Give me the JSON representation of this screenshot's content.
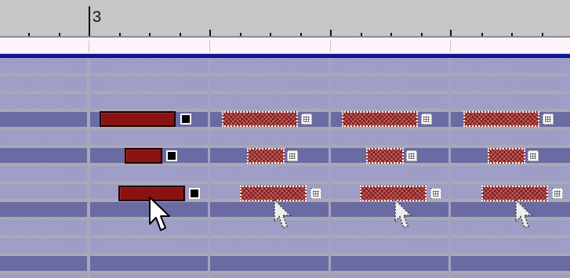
{
  "ruler": {
    "bar_label": "3"
  },
  "cursor_icon": "mouse-pointer-icon",
  "ghost_cursor_icon": "dotted-mouse-pointer-icon",
  "colors": {
    "ruler_bg": "#c6c6c6",
    "header_strip": "#fdf3fb",
    "top_line": "#0c1590",
    "row_inactive": "#9b9bc6",
    "row_active": "#6a6ba3",
    "note_fill": "#8b1212",
    "note_border": "#1a0000"
  }
}
